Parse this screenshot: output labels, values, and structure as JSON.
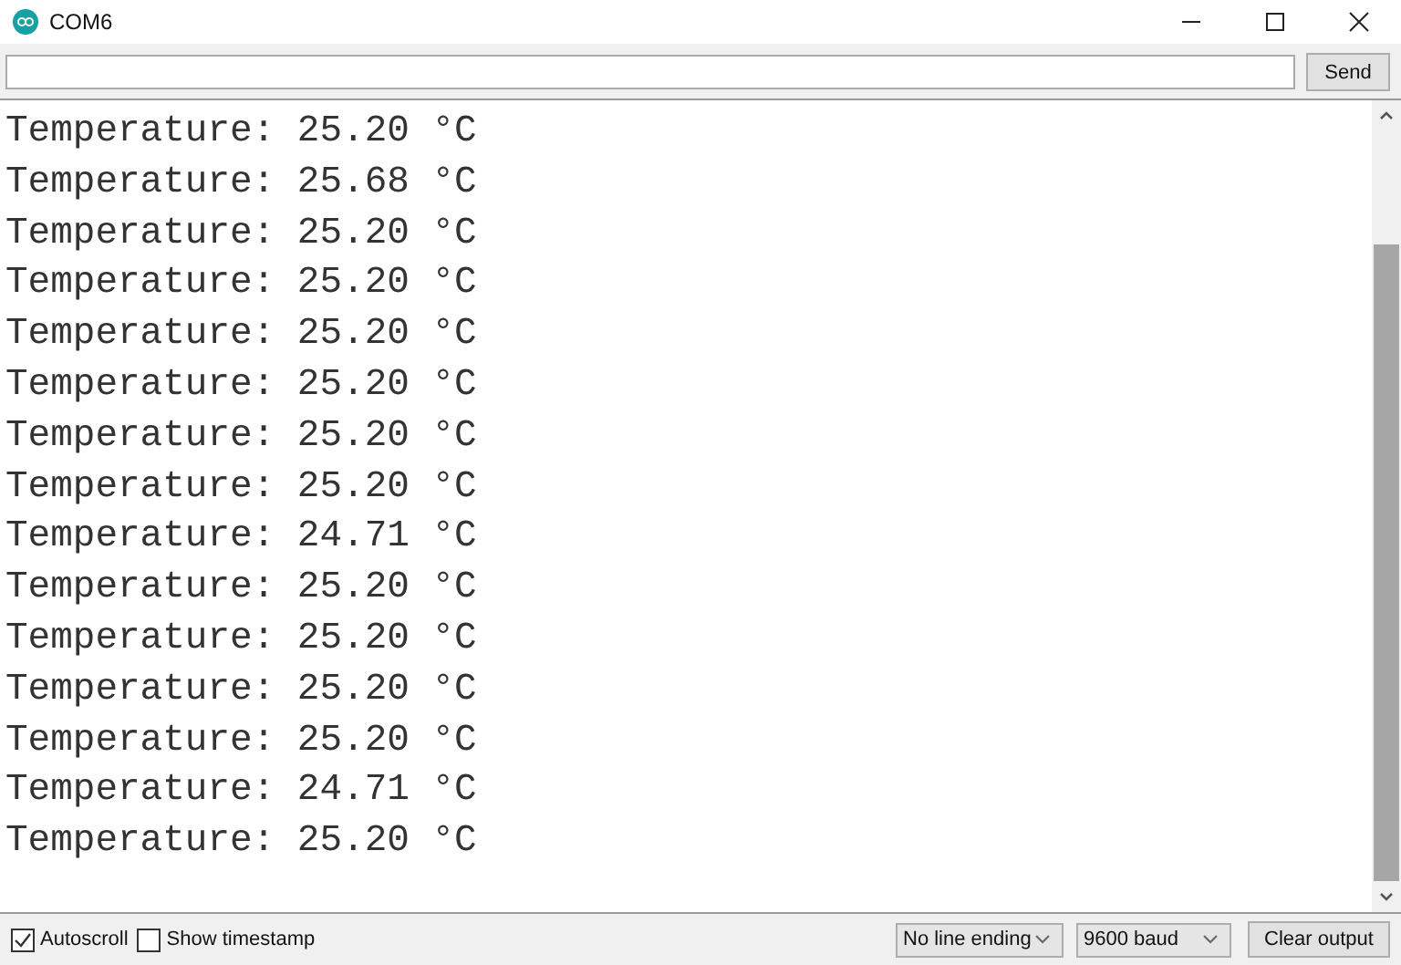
{
  "window": {
    "title": "COM6"
  },
  "send_button": "Send",
  "output_lines": [
    "Temperature: 25.20 °C",
    "Temperature: 25.68 °C",
    "Temperature: 25.20 °C",
    "Temperature: 25.20 °C",
    "Temperature: 25.20 °C",
    "Temperature: 25.20 °C",
    "Temperature: 25.20 °C",
    "Temperature: 25.20 °C",
    "Temperature: 24.71 °C",
    "Temperature: 25.20 °C",
    "Temperature: 25.20 °C",
    "Temperature: 25.20 °C",
    "Temperature: 25.20 °C",
    "Temperature: 24.71 °C",
    "Temperature: 25.20 °C"
  ],
  "options": [
    {
      "label": "Autoscroll",
      "checked": true
    },
    {
      "label": "Show timestamp",
      "checked": false
    }
  ],
  "line_ending": "No line ending",
  "baud_rate": "9600 baud",
  "clear_button": "Clear output"
}
